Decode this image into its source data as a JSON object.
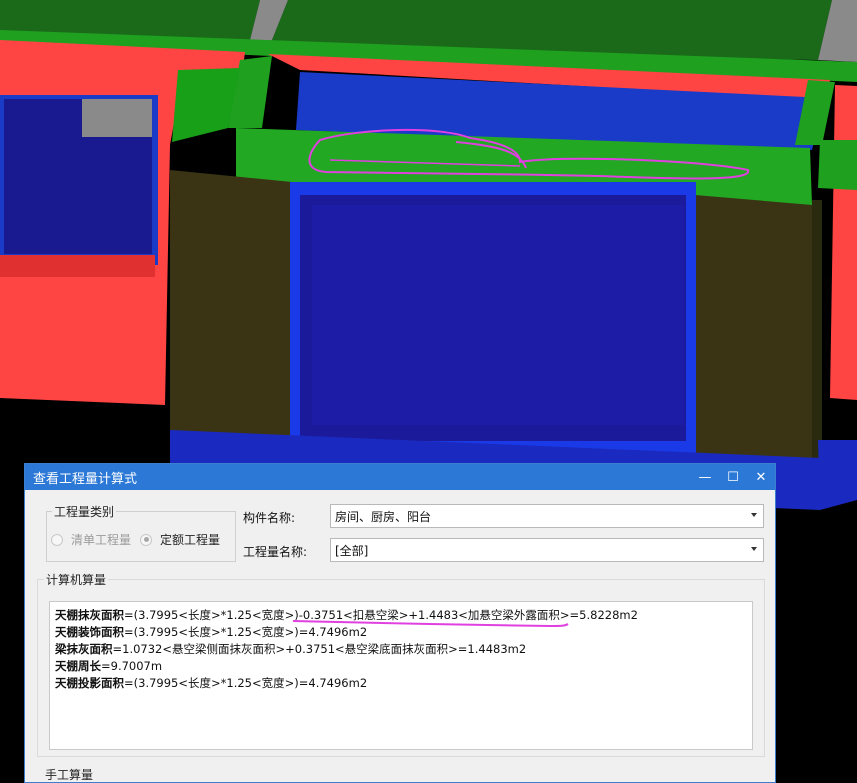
{
  "dialog": {
    "title": "查看工程量计算式",
    "window_buttons": {
      "minimize": "—",
      "maximize": "☐",
      "close": "✕"
    },
    "quantity_type": {
      "legend": "工程量类别",
      "options": [
        {
          "label": "清单工程量",
          "selected": false,
          "enabled": false
        },
        {
          "label": "定额工程量",
          "selected": true,
          "enabled": true
        }
      ]
    },
    "component_name": {
      "label": "构件名称:",
      "value": "房间、厨房、阳台"
    },
    "quantity_name": {
      "label": "工程量名称:",
      "value": "[全部]"
    },
    "computer_calc": {
      "legend": "计算机算量",
      "lines": [
        {
          "name": "天棚抹灰面积",
          "formula": "=(3.7995<长度>*1.25<宽度>)-0.3751<扣悬空梁>+1.4483<加悬空梁外露面积>=5.8228m2"
        },
        {
          "name": "天棚装饰面积",
          "formula": "=(3.7995<长度>*1.25<宽度>)=4.7496m2"
        },
        {
          "name": "梁抹灰面积",
          "formula": "=1.0732<悬空梁侧面抹灰面积>+0.3751<悬空梁底面抹灰面积>=1.4483m2"
        },
        {
          "name": "天棚周长",
          "formula": "=9.7007m"
        },
        {
          "name": "天棚投影面积",
          "formula": "=(3.7995<长度>*1.25<宽度>)=4.7496m2"
        }
      ]
    },
    "manual_calc": {
      "legend": "手工算量"
    }
  },
  "colors": {
    "titlebar": "#2b78d6",
    "wall_red": "#ff4444",
    "beam_green": "#1fa01f",
    "opening_blue": "#1a1a9a",
    "annotation_magenta": "#e040e0"
  }
}
